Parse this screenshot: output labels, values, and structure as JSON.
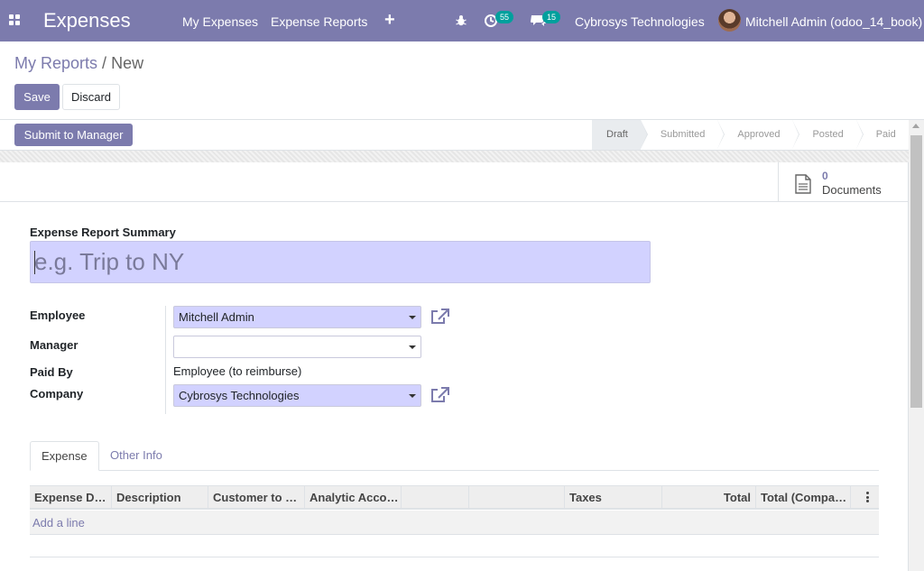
{
  "navbar": {
    "app_title": "Expenses",
    "menu": [
      "My Expenses",
      "Expense Reports"
    ],
    "activity_count": "55",
    "message_count": "15",
    "company": "Cybrosys Technologies",
    "user": "Mitchell Admin (odoo_14_book)",
    "color": "#7c7bad"
  },
  "breadcrumb": {
    "parent": "My Reports",
    "separator": "/",
    "current": "New"
  },
  "actions": {
    "save": "Save",
    "discard": "Discard",
    "submit": "Submit to Manager"
  },
  "statusbar": {
    "stages": [
      "Draft",
      "Submitted",
      "Approved",
      "Posted",
      "Paid"
    ],
    "active": "Draft"
  },
  "smart_button": {
    "count": "0",
    "label": "Documents"
  },
  "form": {
    "summary_label": "Expense Report Summary",
    "summary_placeholder": "e.g. Trip to NY",
    "employee_label": "Employee",
    "employee_value": "Mitchell Admin",
    "manager_label": "Manager",
    "manager_value": "",
    "paid_by_label": "Paid By",
    "paid_by_value": "Employee (to reimburse)",
    "company_label": "Company",
    "company_value": "Cybrosys Technologies"
  },
  "tabs": [
    "Expense",
    "Other Info"
  ],
  "table": {
    "columns": [
      "Expense D…",
      "Description",
      "Customer to …",
      "Analytic Acco…",
      "",
      "",
      "Taxes",
      "Total",
      "Total (Compa…"
    ],
    "add_line": "Add a line"
  }
}
